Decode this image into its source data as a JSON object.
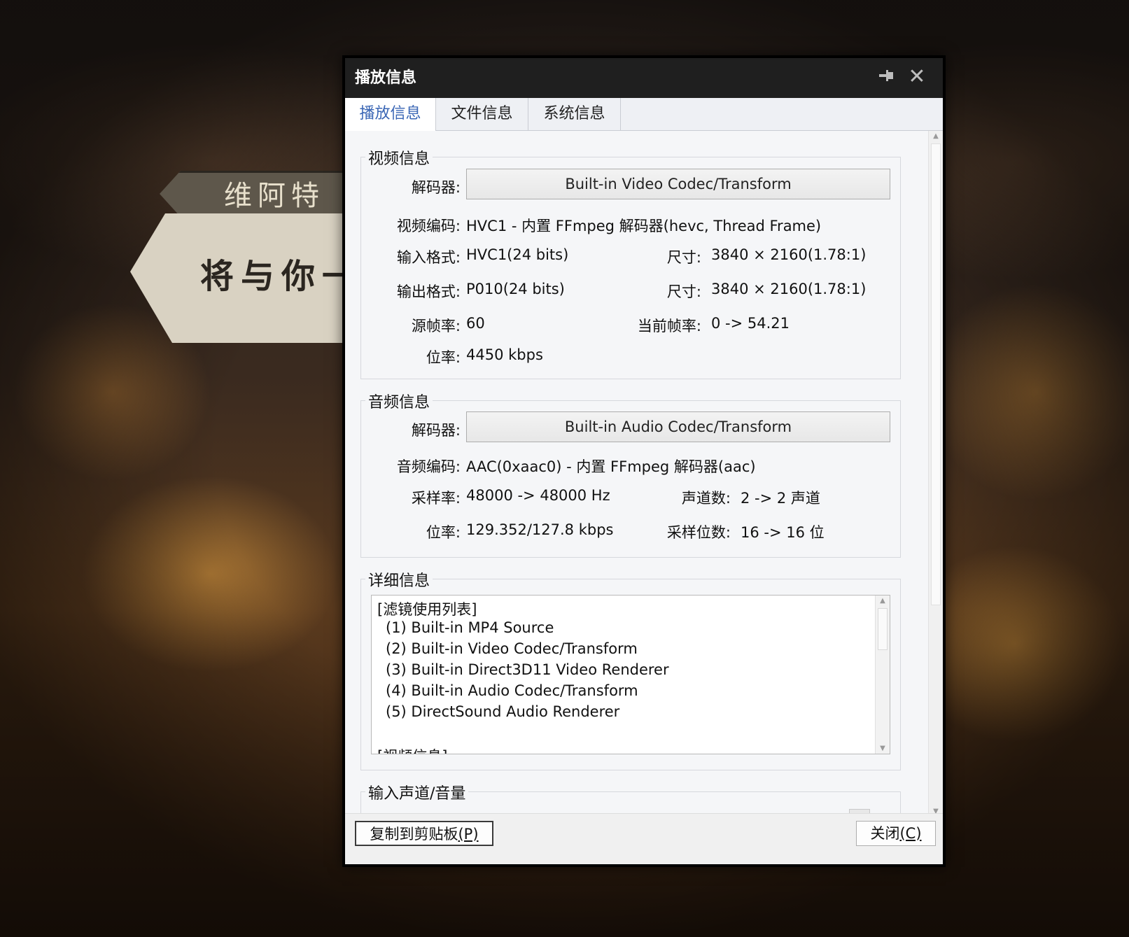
{
  "background": {
    "banner_top_text": "维阿特",
    "banner_main_text": "将与你一"
  },
  "dialog": {
    "title": "播放信息",
    "tabs": [
      "播放信息",
      "文件信息",
      "系统信息"
    ],
    "video": {
      "group_title": "视频信息",
      "decoder_label": "解码器:",
      "decoder_value": "Built-in Video Codec/Transform",
      "codec_label": "视频编码:",
      "codec_value": "HVC1 - 内置 FFmpeg 解码器(hevc, Thread Frame)",
      "input_format_label": "输入格式:",
      "input_format_value": "HVC1(24 bits)",
      "input_size_label": "尺寸:",
      "input_size_value": "3840 × 2160(1.78:1)",
      "output_format_label": "输出格式:",
      "output_format_value": "P010(24 bits)",
      "output_size_label": "尺寸:",
      "output_size_value": "3840 × 2160(1.78:1)",
      "src_fps_label": "源帧率:",
      "src_fps_value": "60",
      "cur_fps_label": "当前帧率:",
      "cur_fps_value": "0 -> 54.21",
      "bitrate_label": "位率:",
      "bitrate_value": "4450 kbps"
    },
    "audio": {
      "group_title": "音频信息",
      "decoder_label": "解码器:",
      "decoder_value": "Built-in Audio Codec/Transform",
      "codec_label": "音频编码:",
      "codec_value": "AAC(0xaac0) - 内置 FFmpeg 解码器(aac)",
      "samplerate_label": "采样率:",
      "samplerate_value": "48000 -> 48000 Hz",
      "channels_label": "声道数:",
      "channels_value": "2 -> 2 声道",
      "bitrate_label": "位率:",
      "bitrate_value": "129.352/127.8 kbps",
      "bits_label": "采样位数:",
      "bits_value": "16 -> 16 位"
    },
    "detail": {
      "group_title": "详细信息",
      "lines": [
        "[滤镜使用列表]",
        " (1) Built-in MP4 Source",
        " (2) Built-in Video Codec/Transform",
        " (3) Built-in Direct3D11 Video Renderer",
        " (4) Built-in Audio Codec/Transform",
        " (5) DirectSound Audio Renderer",
        "",
        "[视频信息]"
      ]
    },
    "input_channels": {
      "group_title": "输入声道/音量"
    },
    "footer": {
      "copy_label": "复制到剪贴板",
      "copy_key": "(P)",
      "close_label": "关闭",
      "close_key": "(C)"
    }
  },
  "icons": {
    "pin": "pin-icon",
    "close": "close-icon",
    "scroll_up": "scroll-up-arrow-icon",
    "scroll_down": "scroll-down-arrow-icon"
  }
}
